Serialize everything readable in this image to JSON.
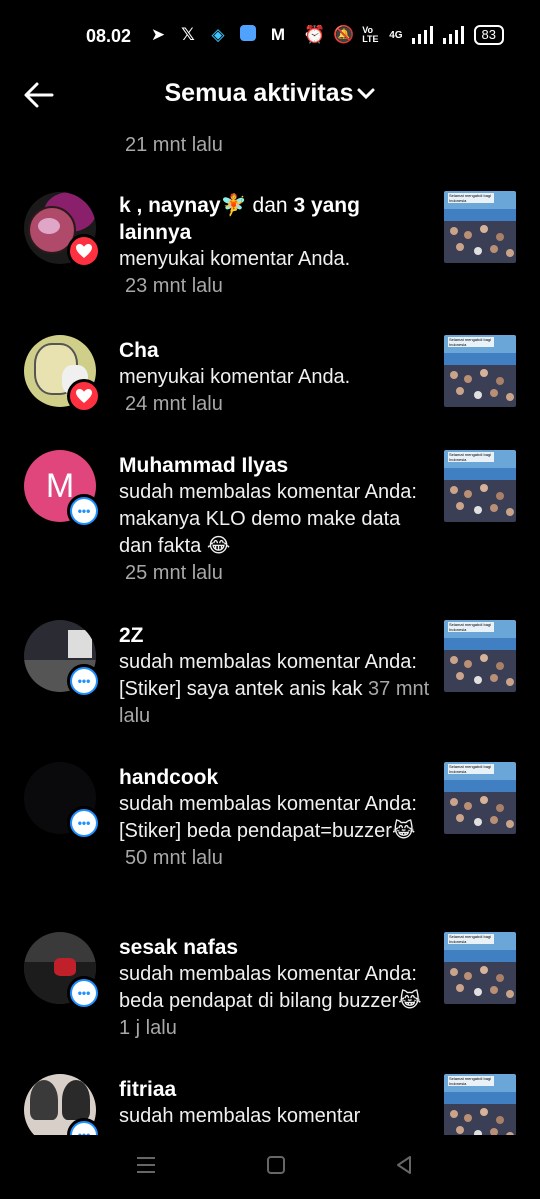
{
  "status_bar": {
    "time": "08.02",
    "battery": "83",
    "network": "4G",
    "volte": "Vo LTE"
  },
  "header": {
    "title": "Semua aktivitas"
  },
  "feed": {
    "top_time": "21 mnt lalu",
    "items": [
      {
        "name": "k , naynay🧚 dan 3 yang lainnya",
        "name_main": "k , naynay🧚",
        "name_rest_prefix": "dan",
        "name_rest": "3 yang lainnya",
        "action": "menyukai komentar Anda.",
        "time": "23 mnt lalu",
        "badge": "heart-icon"
      },
      {
        "name": "Cha",
        "action": "menyukai komentar Anda.",
        "time": "24 mnt lalu",
        "badge": "heart-icon"
      },
      {
        "name": "Muhammad Ilyas",
        "avatar_letter": "M",
        "action": "sudah membalas komentar Anda: makanya KLO demo make data dan fakta 😂",
        "time": "25 mnt lalu",
        "badge": "comment-icon"
      },
      {
        "name": "2Z",
        "action": "sudah membalas komentar Anda: [Stiker] saya antek anis kak",
        "time": "37 mnt lalu",
        "badge": "comment-icon"
      },
      {
        "name": "handcook",
        "action": "sudah membalas komentar Anda: [Stiker] beda pendapat=buzzer😹",
        "time": "50 mnt lalu",
        "badge": "comment-icon"
      },
      {
        "name": "sesak nafas",
        "action": "sudah membalas komentar Anda: beda pendapat di bilang buzzer😹",
        "time": "1 j lalu",
        "badge": "comment-icon"
      },
      {
        "name": "fitriaa",
        "action": "sudah membalas komentar",
        "time": "",
        "badge": "comment-icon"
      }
    ],
    "thumbnail_caption": "Selamat mengabdi bagi Indonesia"
  },
  "colors": {
    "background": "#000000",
    "heart": "#ff3040",
    "comment": "#1e90ff",
    "muted": "#a8a8a8"
  }
}
